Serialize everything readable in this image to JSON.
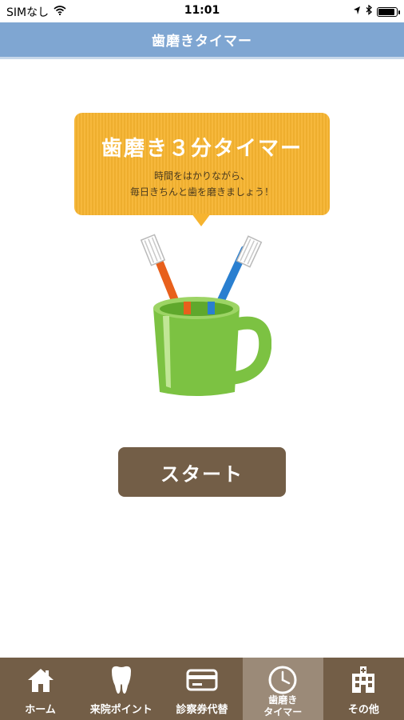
{
  "status_bar": {
    "carrier": "SIMなし",
    "time": "11:01",
    "battery_level": 0.95
  },
  "header": {
    "title": "歯磨きタイマー"
  },
  "bubble": {
    "title": "歯磨き３分タイマー",
    "line1": "時間をはかりながら、",
    "line2": "毎日きちんと歯を磨きましょう！"
  },
  "start_button": {
    "label": "スタート"
  },
  "tabs": [
    {
      "label": "ホーム",
      "icon": "home-icon",
      "active": false
    },
    {
      "label": "来院ポイント",
      "icon": "tooth-icon",
      "active": false
    },
    {
      "label": "診察券代替",
      "icon": "card-icon",
      "active": false
    },
    {
      "label": "歯磨き\nタイマー",
      "icon": "clock-icon",
      "active": true
    },
    {
      "label": "その他",
      "icon": "hospital-icon",
      "active": false
    }
  ],
  "colors": {
    "header": "#7fa6d2",
    "bubble": "#f6b430",
    "button": "#735e47",
    "tab_bar": "#735e47",
    "tab_active": "#9b8a78",
    "cup": "#7cc242",
    "brush_orange": "#e8601c",
    "brush_blue": "#2a7fd0"
  }
}
